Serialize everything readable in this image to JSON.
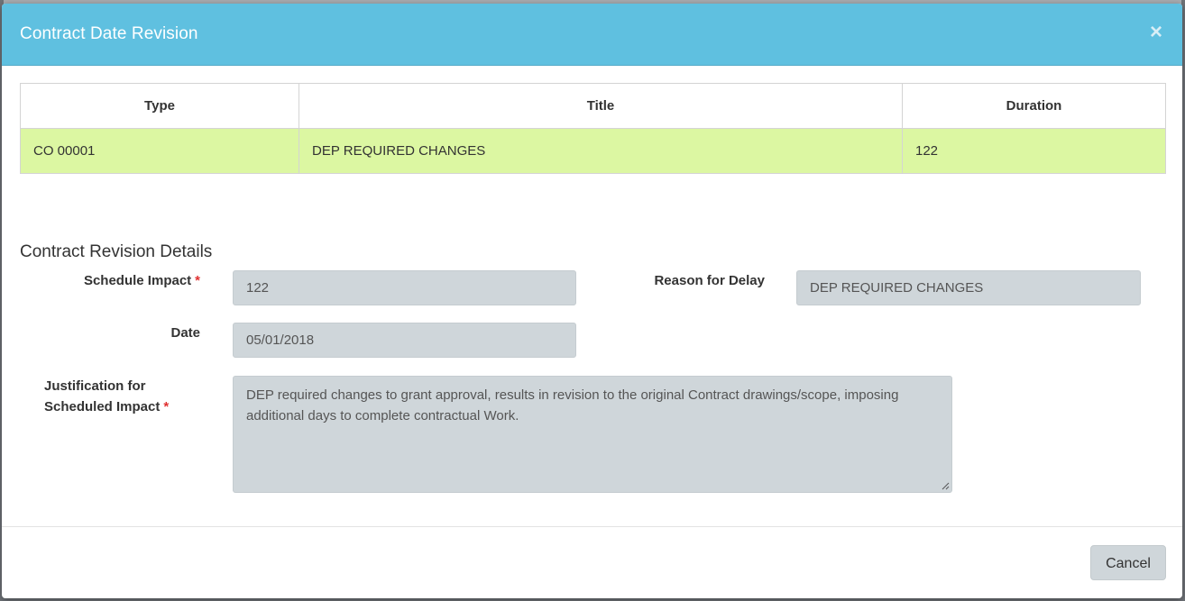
{
  "modal": {
    "title": "Contract Date Revision",
    "close_symbol": "×"
  },
  "table": {
    "headers": [
      "Type",
      "Title",
      "Duration"
    ],
    "rows": [
      [
        "CO 00001",
        "DEP REQUIRED CHANGES",
        "122"
      ]
    ]
  },
  "details": {
    "section_title": "Contract Revision Details",
    "schedule_impact": {
      "label": "Schedule Impact",
      "required": "*",
      "value": "122"
    },
    "reason_for_delay": {
      "label": "Reason for Delay",
      "value": "DEP REQUIRED CHANGES"
    },
    "date": {
      "label": "Date",
      "value": "05/01/2018"
    },
    "justification": {
      "label_line1": "Justification for",
      "label_line2": "Scheduled Impact",
      "required": "*",
      "value": "DEP required changes to grant approval, results in revision to the original Contract drawings/scope, imposing additional days to complete contractual Work."
    }
  },
  "footer": {
    "cancel_label": "Cancel"
  },
  "colors": {
    "header_bg": "#5fc0e0",
    "row_highlight": "#dcf7a2",
    "input_bg": "#cfd6da",
    "required": "#e03131"
  }
}
